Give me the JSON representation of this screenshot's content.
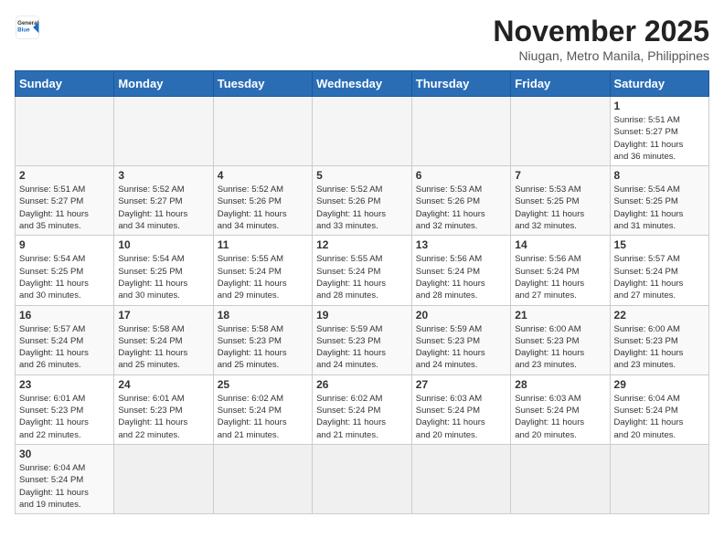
{
  "logo": {
    "line1": "General",
    "line2": "Blue"
  },
  "title": "November 2025",
  "location": "Niugan, Metro Manila, Philippines",
  "weekdays": [
    "Sunday",
    "Monday",
    "Tuesday",
    "Wednesday",
    "Thursday",
    "Friday",
    "Saturday"
  ],
  "weeks": [
    [
      {
        "day": "",
        "info": ""
      },
      {
        "day": "",
        "info": ""
      },
      {
        "day": "",
        "info": ""
      },
      {
        "day": "",
        "info": ""
      },
      {
        "day": "",
        "info": ""
      },
      {
        "day": "",
        "info": ""
      },
      {
        "day": "1",
        "info": "Sunrise: 5:51 AM\nSunset: 5:27 PM\nDaylight: 11 hours\nand 36 minutes."
      }
    ],
    [
      {
        "day": "2",
        "info": "Sunrise: 5:51 AM\nSunset: 5:27 PM\nDaylight: 11 hours\nand 35 minutes."
      },
      {
        "day": "3",
        "info": "Sunrise: 5:52 AM\nSunset: 5:27 PM\nDaylight: 11 hours\nand 34 minutes."
      },
      {
        "day": "4",
        "info": "Sunrise: 5:52 AM\nSunset: 5:26 PM\nDaylight: 11 hours\nand 34 minutes."
      },
      {
        "day": "5",
        "info": "Sunrise: 5:52 AM\nSunset: 5:26 PM\nDaylight: 11 hours\nand 33 minutes."
      },
      {
        "day": "6",
        "info": "Sunrise: 5:53 AM\nSunset: 5:26 PM\nDaylight: 11 hours\nand 32 minutes."
      },
      {
        "day": "7",
        "info": "Sunrise: 5:53 AM\nSunset: 5:25 PM\nDaylight: 11 hours\nand 32 minutes."
      },
      {
        "day": "8",
        "info": "Sunrise: 5:54 AM\nSunset: 5:25 PM\nDaylight: 11 hours\nand 31 minutes."
      }
    ],
    [
      {
        "day": "9",
        "info": "Sunrise: 5:54 AM\nSunset: 5:25 PM\nDaylight: 11 hours\nand 30 minutes."
      },
      {
        "day": "10",
        "info": "Sunrise: 5:54 AM\nSunset: 5:25 PM\nDaylight: 11 hours\nand 30 minutes."
      },
      {
        "day": "11",
        "info": "Sunrise: 5:55 AM\nSunset: 5:24 PM\nDaylight: 11 hours\nand 29 minutes."
      },
      {
        "day": "12",
        "info": "Sunrise: 5:55 AM\nSunset: 5:24 PM\nDaylight: 11 hours\nand 28 minutes."
      },
      {
        "day": "13",
        "info": "Sunrise: 5:56 AM\nSunset: 5:24 PM\nDaylight: 11 hours\nand 28 minutes."
      },
      {
        "day": "14",
        "info": "Sunrise: 5:56 AM\nSunset: 5:24 PM\nDaylight: 11 hours\nand 27 minutes."
      },
      {
        "day": "15",
        "info": "Sunrise: 5:57 AM\nSunset: 5:24 PM\nDaylight: 11 hours\nand 27 minutes."
      }
    ],
    [
      {
        "day": "16",
        "info": "Sunrise: 5:57 AM\nSunset: 5:24 PM\nDaylight: 11 hours\nand 26 minutes."
      },
      {
        "day": "17",
        "info": "Sunrise: 5:58 AM\nSunset: 5:24 PM\nDaylight: 11 hours\nand 25 minutes."
      },
      {
        "day": "18",
        "info": "Sunrise: 5:58 AM\nSunset: 5:23 PM\nDaylight: 11 hours\nand 25 minutes."
      },
      {
        "day": "19",
        "info": "Sunrise: 5:59 AM\nSunset: 5:23 PM\nDaylight: 11 hours\nand 24 minutes."
      },
      {
        "day": "20",
        "info": "Sunrise: 5:59 AM\nSunset: 5:23 PM\nDaylight: 11 hours\nand 24 minutes."
      },
      {
        "day": "21",
        "info": "Sunrise: 6:00 AM\nSunset: 5:23 PM\nDaylight: 11 hours\nand 23 minutes."
      },
      {
        "day": "22",
        "info": "Sunrise: 6:00 AM\nSunset: 5:23 PM\nDaylight: 11 hours\nand 23 minutes."
      }
    ],
    [
      {
        "day": "23",
        "info": "Sunrise: 6:01 AM\nSunset: 5:23 PM\nDaylight: 11 hours\nand 22 minutes."
      },
      {
        "day": "24",
        "info": "Sunrise: 6:01 AM\nSunset: 5:23 PM\nDaylight: 11 hours\nand 22 minutes."
      },
      {
        "day": "25",
        "info": "Sunrise: 6:02 AM\nSunset: 5:24 PM\nDaylight: 11 hours\nand 21 minutes."
      },
      {
        "day": "26",
        "info": "Sunrise: 6:02 AM\nSunset: 5:24 PM\nDaylight: 11 hours\nand 21 minutes."
      },
      {
        "day": "27",
        "info": "Sunrise: 6:03 AM\nSunset: 5:24 PM\nDaylight: 11 hours\nand 20 minutes."
      },
      {
        "day": "28",
        "info": "Sunrise: 6:03 AM\nSunset: 5:24 PM\nDaylight: 11 hours\nand 20 minutes."
      },
      {
        "day": "29",
        "info": "Sunrise: 6:04 AM\nSunset: 5:24 PM\nDaylight: 11 hours\nand 20 minutes."
      }
    ],
    [
      {
        "day": "30",
        "info": "Sunrise: 6:04 AM\nSunset: 5:24 PM\nDaylight: 11 hours\nand 19 minutes."
      },
      {
        "day": "",
        "info": ""
      },
      {
        "day": "",
        "info": ""
      },
      {
        "day": "",
        "info": ""
      },
      {
        "day": "",
        "info": ""
      },
      {
        "day": "",
        "info": ""
      },
      {
        "day": "",
        "info": ""
      }
    ]
  ]
}
